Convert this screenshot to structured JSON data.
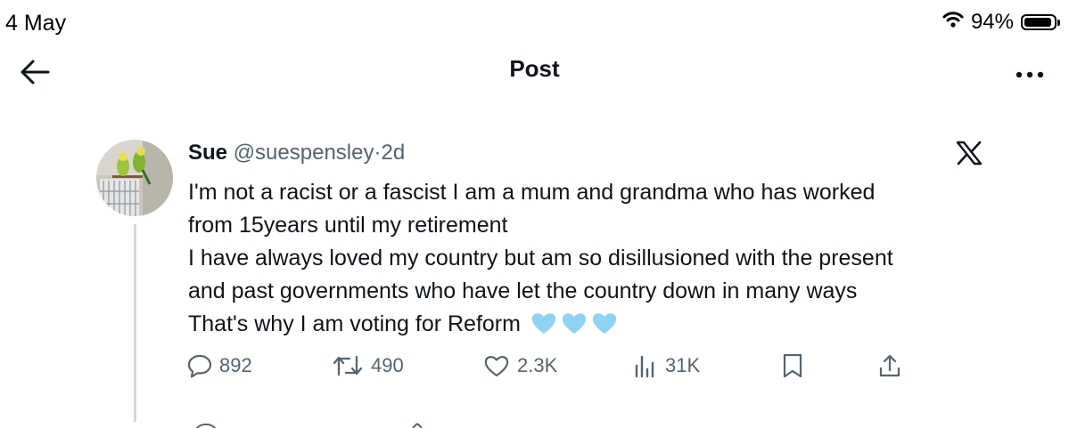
{
  "status_bar": {
    "date": "4 May",
    "battery_percent": "94%",
    "battery_level": 0.94
  },
  "header": {
    "title": "Post"
  },
  "tweet": {
    "display_name": "Sue",
    "handle": "@suespensley",
    "separator": "·",
    "time": "2d",
    "lines": [
      "I'm not a racist or a fascist I am a mum and grandma who has worked",
      "from 15years until my retirement",
      "I have always loved my country but am so disillusioned with the present",
      "and past governments who have let the country down in many ways",
      "That's why I am voting for Reform"
    ],
    "emoji": [
      "light-blue-heart",
      "light-blue-heart",
      "light-blue-heart"
    ]
  },
  "actions": {
    "replies": "892",
    "reposts": "490",
    "likes": "2.3K",
    "views": "31K"
  },
  "colors": {
    "text": "#0f1419",
    "secondary": "#536471",
    "thread_line": "#cfd9de",
    "heart": "#8fd3f4"
  }
}
